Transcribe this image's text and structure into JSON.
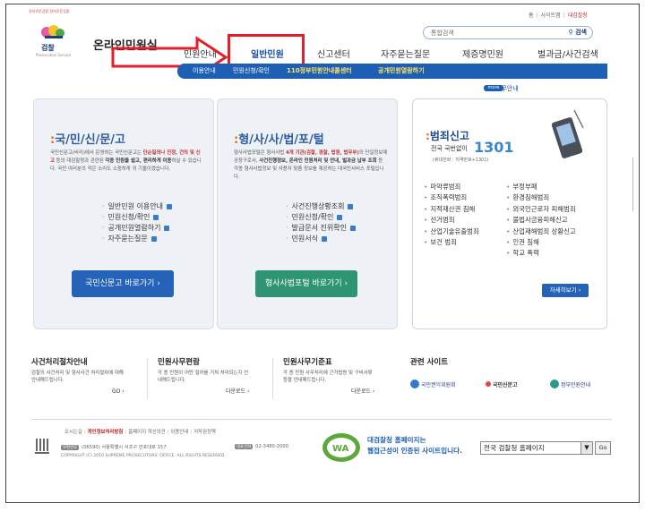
{
  "util": {
    "home": "홈",
    "sitemap": "사이트맵",
    "main": "대검찰청"
  },
  "logo": {
    "name": "검찰",
    "sub": "Prosecution Service",
    "ring": "정의로운검찰 정의로운검찰"
  },
  "site_title": "온라인민원실",
  "search": {
    "placeholder": "통합검색",
    "button": "검색"
  },
  "gnb": [
    "민원안내",
    "일반민원",
    "신고센터",
    "자주묻는질문",
    "제증명민원",
    "벌과금/사건검색"
  ],
  "subnav": [
    "이용안내",
    "민원신청/확인",
    "110정부민원안내콜센터",
    "공개민원열람하기"
  ],
  "section_label": "민원사무안내",
  "section_more": "more",
  "panel1": {
    "title_pre": "국",
    "title": "국/민/신/문/고",
    "desc_1": "국민신문고(비리)에서 운영하는 국민신문고는 ",
    "desc_hl1": "단순질의나 진정, 건의 및 신고",
    "desc_2": " 등의 대검찰청과 관련된 ",
    "desc_hl2": "각종 민원을 쉽고, 편리하게 이용",
    "desc_3": "하실 수 있습니다. 국민 여러분의 작은 소리도 소중하게 귀 기울이겠습니다.",
    "items": [
      "일반민원 이용안내",
      "민원신청/확인",
      "공개민원열람하기",
      "자주묻는질문"
    ],
    "button": "국민신문고 바로가기 ›"
  },
  "panel2": {
    "title": "형/사/사/법/포/털",
    "desc_1": "형사사법포털은 형사사법 ",
    "desc_hl1": "4개 기관(검찰, 경찰, 법원, 법무부)",
    "desc_2": "의 단일정보제공창구로서, ",
    "desc_hl2": "사건진행정보, 온라인 민원처리 및 안내, 벌과금 납부 조회",
    "desc_3": " 등 각종 형사사법정보 및 사용자 맞춤 정보를 제공하는 대국민서비스 포털입니다.",
    "items": [
      "사건진행상황조회",
      "민원신청/확인",
      "발급문서 진위확인",
      "민원서식"
    ],
    "button": "형사사법포털 바로가기 ›"
  },
  "panel3": {
    "title": "범죄신고",
    "sub": "전국 국번없이",
    "number": "1301",
    "note": "(휴대전화 : 지역번호+1301)",
    "col_a": [
      "마약류범죄",
      "조직폭력범죄",
      "지적재산권 침해",
      "선거범죄",
      "산업기술유출범죄",
      "보건 범죄"
    ],
    "col_b": [
      "부정부패",
      "환경침해범죄",
      "외국인근로자 피해범죄",
      "불법사금융피해신고",
      "산업재해범죄 상황신고",
      "인권 침해",
      "학교 폭력"
    ],
    "button": "자세히보기 ›"
  },
  "bottom": [
    {
      "title": "사건처리절차안내",
      "desc": "검찰의 사건처리 및 형사사건 처리절차에 대해 안내해드립니다.",
      "more": "GO ›"
    },
    {
      "title": "민원사무편람",
      "desc": "각 종 민원이 어떤 절차를 거쳐 처리되는지 안내해드립니다.",
      "more": "다운로드 ›"
    },
    {
      "title": "민원사무기준표",
      "desc": "각 종 민원 사무처리에 근거법령 및 구비서류 등을 안내해드립니다.",
      "more": "다운로드 ›"
    },
    {
      "title": "관련 사이트",
      "desc": "",
      "more": ""
    }
  ],
  "related_sites": [
    "국민권익위원회",
    "국민신문고",
    "정부민원안내"
  ],
  "footer": {
    "links": [
      "오시는길",
      "개인정보처리방침",
      "홈페이지 개선의견",
      "이용안내",
      "저작권정책"
    ],
    "addr_tag": "우편번호",
    "addr": "(06590) 서울특별시 서초구 반포대로 157",
    "phone_tag": "대표전화",
    "phone": "02-3480-2000",
    "copyright": "COPYRIGHT (C) 2010 SUPREME PROSECUTORS' OFFICE. ALL RIGHTS RESERVED",
    "wa_line1": "대검찰청 홈페이지는",
    "wa_line2": "웹접근성이 인증된 사이트입니다.",
    "select": "전국 검찰청 홈페이지",
    "go": "Go"
  },
  "colors": {
    "brand": "#1d5fb3",
    "highlight": "#e0202a",
    "green": "#2e9472"
  }
}
